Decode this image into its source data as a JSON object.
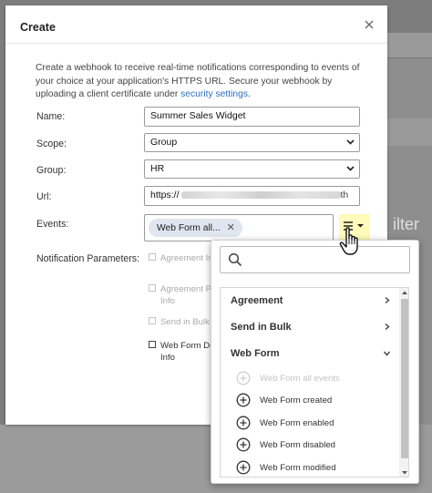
{
  "modal": {
    "title": "Create",
    "description_text": "Create a webhook to receive real-time notifications corresponding to events of your choice at your application's HTTPS URL. Secure your webhook by uploading a client certificate under ",
    "description_link": "security settings",
    "description_end": "."
  },
  "form": {
    "name_label": "Name:",
    "name_value": "Summer Sales Widget",
    "scope_label": "Scope:",
    "scope_value": "Group",
    "group_label": "Group:",
    "group_value": "HR",
    "url_label": "Url:",
    "url_prefix": "https://",
    "url_suffix": "th",
    "events_label": "Events:",
    "event_chip": "Web Form all...",
    "notification_label": "Notification Parameters:"
  },
  "notification_params": [
    {
      "label": "Agreement Inf",
      "enabled": false
    },
    {
      "label": "Agreement Pa Info",
      "enabled": false
    },
    {
      "label": "Send in Bulk I",
      "enabled": false
    },
    {
      "label": "Web Form Do Info",
      "enabled": true
    }
  ],
  "dropdown": {
    "search_placeholder": "",
    "categories": [
      {
        "label": "Agreement",
        "expanded": false
      },
      {
        "label": "Send in Bulk",
        "expanded": false
      },
      {
        "label": "Web Form",
        "expanded": true
      }
    ],
    "items": [
      {
        "label": "Web Form all events",
        "disabled": true
      },
      {
        "label": "Web Form created",
        "disabled": false
      },
      {
        "label": "Web Form enabled",
        "disabled": false
      },
      {
        "label": "Web Form disabled",
        "disabled": false
      },
      {
        "label": "Web Form modified",
        "disabled": false
      }
    ]
  },
  "background": {
    "filter_text": "ilter"
  },
  "colors": {
    "link": "#2d6fc2",
    "chip_bg": "#dfe6ef",
    "toggle_highlight": "#fffbb8",
    "overlay": "#7d7d7d"
  }
}
